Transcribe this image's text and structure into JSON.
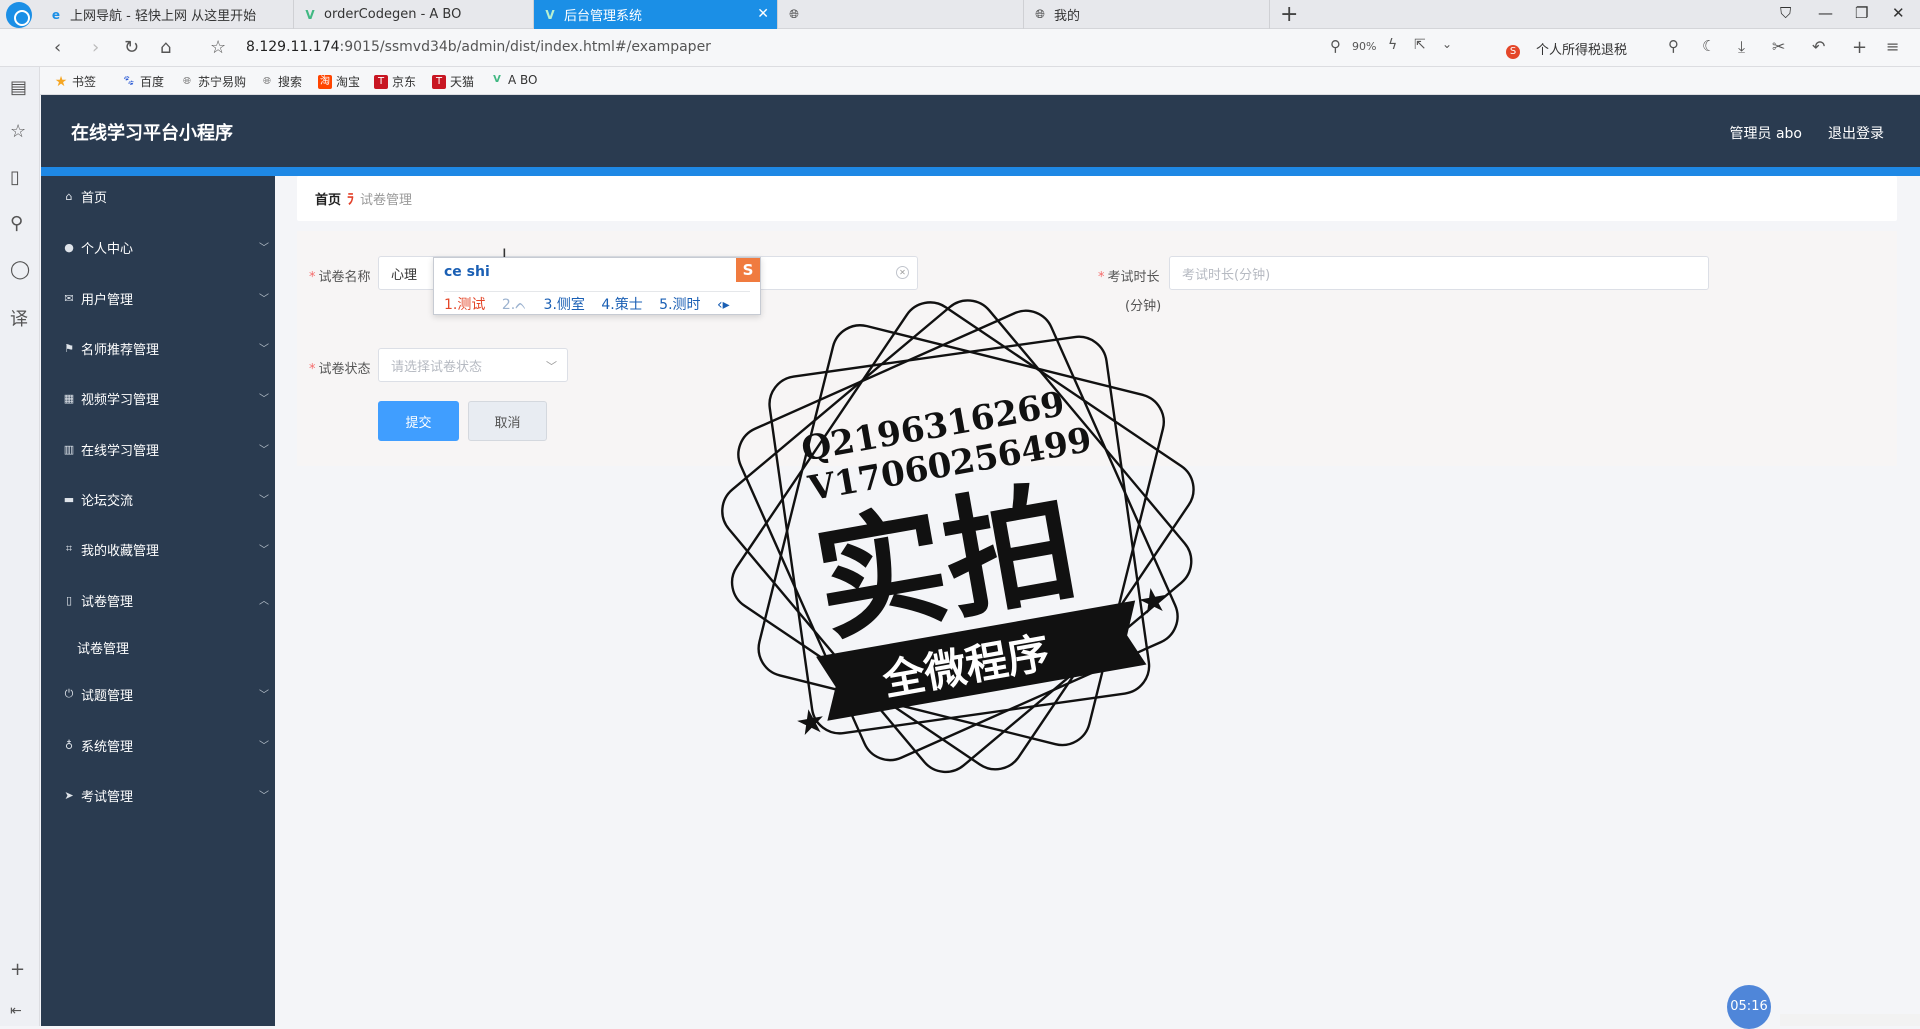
{
  "browser": {
    "tabs": [
      {
        "label": "上网导航 - 轻快上网 从这里开始",
        "icon": "e-browser-icon",
        "active": false
      },
      {
        "label": "orderCodegen - A BO",
        "icon": "vue-icon",
        "active": false
      },
      {
        "label": "后台管理系统",
        "icon": "vue-icon",
        "active": true
      },
      {
        "label": "",
        "icon": "globe-icon",
        "active": false
      },
      {
        "label": "我的",
        "icon": "globe-icon",
        "active": false
      }
    ],
    "url_host": "8.129.11.174",
    "url_rest": ":9015/ssmvd34b/admin/dist/index.html#/exampaper",
    "zoom": "90%",
    "search_engine_label": "个人所得税退税",
    "bookmarks": [
      "书签",
      "百度",
      "苏宁易购",
      "搜索",
      "淘宝",
      "京东",
      "天猫",
      "A BO"
    ]
  },
  "app": {
    "brand": "在线学习平台小程序",
    "admin_label": "管理员 abo",
    "logout_label": "退出登录"
  },
  "sidebar": {
    "items": [
      {
        "label": "首页",
        "icon": "home-icon",
        "has_arrow": false
      },
      {
        "label": "个人中心",
        "icon": "user-icon",
        "has_arrow": true
      },
      {
        "label": "用户管理",
        "icon": "mail-icon",
        "has_arrow": true
      },
      {
        "label": "名师推荐管理",
        "icon": "flag-icon",
        "has_arrow": true
      },
      {
        "label": "视频学习管理",
        "icon": "grid-icon",
        "has_arrow": true
      },
      {
        "label": "在线学习管理",
        "icon": "clipboard-icon",
        "has_arrow": true
      },
      {
        "label": "论坛交流",
        "icon": "printer-icon",
        "has_arrow": true
      },
      {
        "label": "我的收藏管理",
        "icon": "crop-icon",
        "has_arrow": true
      },
      {
        "label": "试卷管理",
        "icon": "phone-icon",
        "has_arrow": true,
        "expanded": true
      },
      {
        "label": "试题管理",
        "icon": "power-icon",
        "has_arrow": true
      },
      {
        "label": "系统管理",
        "icon": "mic-icon",
        "has_arrow": true
      },
      {
        "label": "考试管理",
        "icon": "send-icon",
        "has_arrow": true
      }
    ],
    "subitem": "试卷管理"
  },
  "breadcrumb": {
    "home": "首页",
    "current": "试卷管理"
  },
  "form": {
    "name_label": "试卷名称",
    "name_value": "心理",
    "duration_label": "考试时长",
    "duration_unit": "(分钟)",
    "duration_placeholder": "考试时长(分钟)",
    "status_label": "试卷状态",
    "status_placeholder": "请选择试卷状态",
    "submit_label": "提交",
    "cancel_label": "取消"
  },
  "ime": {
    "composition": "ce shi",
    "candidates": [
      "1.测试",
      "2.ᨈ",
      "3.侧室",
      "4.策士",
      "5.测时"
    ]
  },
  "watermark": {
    "line1": "Q2196316269",
    "line2": "V17060256499",
    "big": "实拍",
    "ribbon": "全微程序"
  },
  "clock": "05:16",
  "colors": {
    "header_bg": "#2a3b50",
    "accent": "#1e88e5",
    "primary": "#409eff",
    "required": "#f56c6c"
  }
}
